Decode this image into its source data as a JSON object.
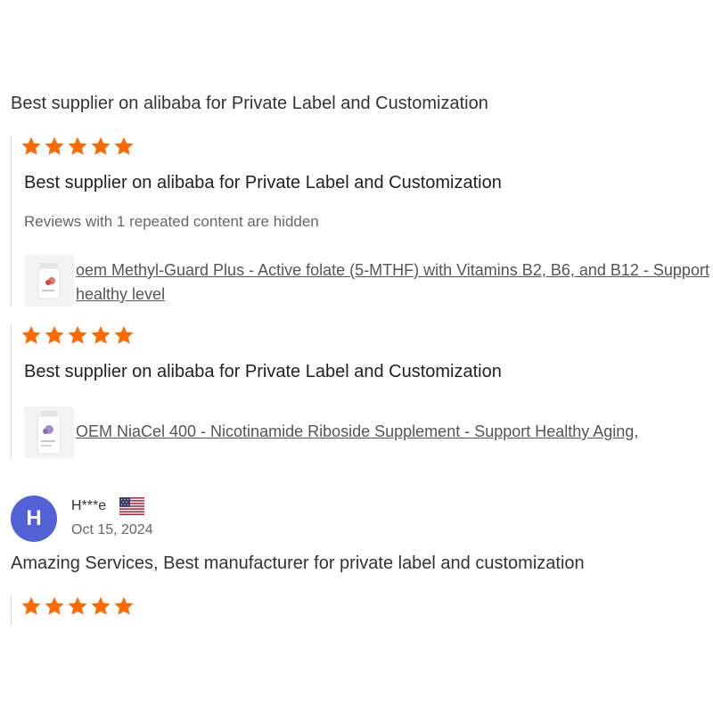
{
  "summary": {
    "text": "Best supplier on alibaba for Private Label and Customization"
  },
  "colors": {
    "star": "#ff6a00",
    "avatar": "#5262d6",
    "divider": "#d9d9d9"
  },
  "reviews": [
    {
      "rating": 5,
      "text": "Best supplier on alibaba for Private Label and Customization",
      "hidden_note": "Reviews with 1 repeated content are hidden",
      "product": {
        "icon": "supplement-bottle-icon",
        "title": "oem Methyl-Guard Plus - Active folate (5-MTHF) with Vitamins B2, B6, and B12 - Support healthy level"
      }
    },
    {
      "rating": 5,
      "text": "Best supplier on alibaba for Private Label and Customization",
      "product": {
        "icon": "supplement-bottle-icon",
        "title": "OEM NiaCel 400 - Nicotinamide Riboside Supplement - Support Healthy Aging,"
      }
    }
  ],
  "second_review": {
    "avatar_letter": "H",
    "reviewer_name": "H***e",
    "flag_icon": "us-flag-icon",
    "date": "Oct 15, 2024",
    "text": "Amazing Services, Best manufacturer for private label and customization",
    "rating": 5
  }
}
